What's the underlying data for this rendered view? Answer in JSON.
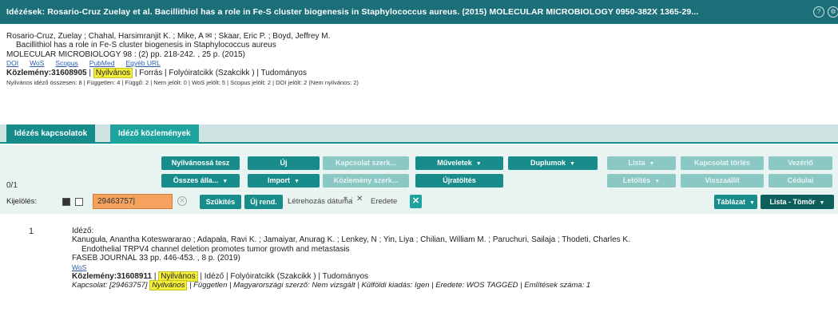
{
  "window": {
    "title": "Idézések: Rosario-Cruz Zuelay et al. Bacillithiol has a role in Fe-S cluster biogenesis in Staphylococcus aureus. (2015) MOLECULAR MICROBIOLOGY 0950-382X 1365-29..."
  },
  "record": {
    "authors": "Rosario-Cruz, Zuelay ; Chahal, Harsimranjit K. ; Mike, A ✉ ; Skaar, Eric P. ; Boyd, Jeffrey M.",
    "title": "Bacillithiol has a role in Fe-S cluster biogenesis in Staphylococcus aureus",
    "journal": "MOLECULAR MICROBIOLOGY 98 : (2) pp. 218-242. , 25 p. (2015)",
    "links": [
      "DOI",
      "WoS",
      "Scopus",
      "PubMed",
      "Egyéb URL"
    ],
    "pub_label": "Közlemény:31608905",
    "status": "Nyilvános",
    "classification": "| Forrás | Folyóiratcikk (Szakcikk ) | Tudományos",
    "summary": "Nyilvános idéző összesen: 8 | Független: 4 | Függő: 2 | Nem jelölt: 0 | WoS jelölt: 5 | Scopus jelölt: 2 | DOI jelölt: 2 (Nem nyilvános: 2)"
  },
  "tabs": [
    {
      "label": "Idézés kapcsolatok"
    },
    {
      "label": "Idéző közlemények"
    }
  ],
  "toolbar": {
    "counter": "0/1",
    "buttons_row1": [
      {
        "label": "Nyilvánossá tesz",
        "caret": false
      },
      {
        "label": "Új",
        "caret": false
      },
      {
        "label": "Kapcsolat szerk...",
        "caret": false
      },
      {
        "label": "Műveletek",
        "caret": true
      },
      {
        "label": "Duplumok",
        "caret": true
      },
      {
        "label": "Lista",
        "caret": true
      },
      {
        "label": "Kapcsolat törlés",
        "caret": false
      },
      {
        "label": "Vezérlő",
        "caret": false
      }
    ],
    "buttons_row2": [
      {
        "label": "Összes álla...",
        "caret": true
      },
      {
        "label": "Import",
        "caret": true
      },
      {
        "label": "Közlemény szerk...",
        "caret": false
      },
      {
        "label": "Újratöltés",
        "caret": false
      },
      {
        "label": "Letöltés",
        "caret": true
      },
      {
        "label": "Visszaállít",
        "caret": false
      },
      {
        "label": "Cédulai",
        "caret": false
      }
    ]
  },
  "filter": {
    "select_label": "Kijelölés:",
    "search_value": "29463757|",
    "search_button": "Szűkítés",
    "new_button": "Új rend.",
    "date_label": "Létrehozás dátuma",
    "origin_label": "Eredete",
    "table_button": "Táblázat",
    "list_button": "Lista - Tömör"
  },
  "result": {
    "number": "1",
    "type_label": "Idéző:",
    "authors": "Kanuguła, Anantha Koteswararao ; Adapała, Ravi K. ; Jamaiyar, Anurag K. ; Lenkey, N ; Yin, Liya ; Chilian, William M. ; Paruchuri, Sailaja ; Thodeti, Charles K.",
    "title": "Endothelial TRPV4 channel deletion promotes tumor growth and metastasis",
    "journal": "FASEB JOURNAL 33 pp. 446-453. , 8 p. (2019)",
    "links": [
      "WoS"
    ],
    "pub_label": "Közlemény:31608911",
    "status": "Nyilvános",
    "classification": "| Idéző | Folyóiratcikk (Szakcikk ) | Tudományos",
    "relation_prefix": "Kapcsolat: [29463757]",
    "relation_status": "Nyilvános",
    "relation_detail": "| Független | Magyarországi szerző: Nem vizsgált | Külföldi kiadás: Igen | Eredete: WOS TAGGED | Említések száma: 1"
  }
}
